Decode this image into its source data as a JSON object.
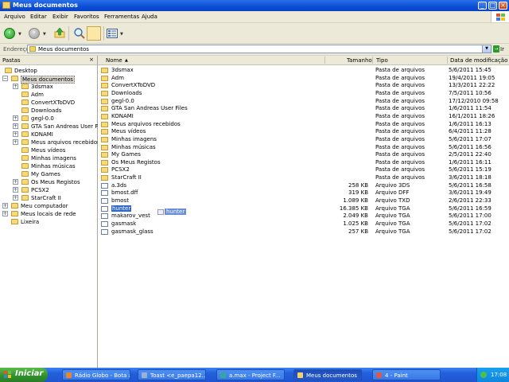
{
  "window": {
    "title": "Meus documentos"
  },
  "menu": [
    "Arquivo",
    "Editar",
    "Exibir",
    "Favoritos",
    "Ferramentas",
    "Ajuda"
  ],
  "address": {
    "label": "Endereço",
    "value": "Meus documentos",
    "go": "Ir"
  },
  "folder_pane": {
    "title": "Pastas",
    "close": "×",
    "tree": [
      {
        "label": "Desktop",
        "level": 0,
        "expander": ""
      },
      {
        "label": "Meus documentos",
        "level": 1,
        "expander": "−",
        "selected": true
      },
      {
        "label": "3dsmax",
        "level": 2,
        "expander": "+"
      },
      {
        "label": "Adm",
        "level": 2,
        "expander": ""
      },
      {
        "label": "ConvertXToDVD",
        "level": 2,
        "expander": ""
      },
      {
        "label": "Downloads",
        "level": 2,
        "expander": ""
      },
      {
        "label": "gegl-0.0",
        "level": 2,
        "expander": "+"
      },
      {
        "label": "GTA San Andreas User Files",
        "level": 2,
        "expander": "+"
      },
      {
        "label": "KONAMI",
        "level": 2,
        "expander": "+"
      },
      {
        "label": "Meus arquivos recebidos",
        "level": 2,
        "expander": "+"
      },
      {
        "label": "Meus vídeos",
        "level": 2,
        "expander": ""
      },
      {
        "label": "Minhas imagens",
        "level": 2,
        "expander": ""
      },
      {
        "label": "Minhas músicas",
        "level": 2,
        "expander": ""
      },
      {
        "label": "My Games",
        "level": 2,
        "expander": ""
      },
      {
        "label": "Os Meus Registos",
        "level": 2,
        "expander": "+"
      },
      {
        "label": "PCSX2",
        "level": 2,
        "expander": "+"
      },
      {
        "label": "StarCraft II",
        "level": 2,
        "expander": "+"
      },
      {
        "label": "Meu computador",
        "level": 1,
        "expander": "+"
      },
      {
        "label": "Meus locais de rede",
        "level": 1,
        "expander": "+"
      },
      {
        "label": "Lixeira",
        "level": 1,
        "expander": ""
      }
    ]
  },
  "columns": {
    "name": "Nome",
    "size": "Tamanho",
    "type": "Tipo",
    "date": "Data de modificação"
  },
  "files": [
    {
      "name": "3dsmax",
      "size": "",
      "type": "Pasta de arquivos",
      "date": "5/6/2011 15:45",
      "kind": "folder"
    },
    {
      "name": "Adm",
      "size": "",
      "type": "Pasta de arquivos",
      "date": "19/4/2011 19:05",
      "kind": "folder"
    },
    {
      "name": "ConvertXToDVD",
      "size": "",
      "type": "Pasta de arquivos",
      "date": "13/3/2011 22:22",
      "kind": "folder"
    },
    {
      "name": "Downloads",
      "size": "",
      "type": "Pasta de arquivos",
      "date": "7/5/2011 10:56",
      "kind": "folder"
    },
    {
      "name": "gegl-0.0",
      "size": "",
      "type": "Pasta de arquivos",
      "date": "17/12/2010 09:58",
      "kind": "folder"
    },
    {
      "name": "GTA San Andreas User Files",
      "size": "",
      "type": "Pasta de arquivos",
      "date": "1/6/2011 11:54",
      "kind": "folder"
    },
    {
      "name": "KONAMI",
      "size": "",
      "type": "Pasta de arquivos",
      "date": "16/1/2011 18:26",
      "kind": "folder"
    },
    {
      "name": "Meus arquivos recebidos",
      "size": "",
      "type": "Pasta de arquivos",
      "date": "1/6/2011 16:13",
      "kind": "folder"
    },
    {
      "name": "Meus vídeos",
      "size": "",
      "type": "Pasta de arquivos",
      "date": "6/4/2011 11:28",
      "kind": "folder"
    },
    {
      "name": "Minhas imagens",
      "size": "",
      "type": "Pasta de arquivos",
      "date": "5/6/2011 17:07",
      "kind": "folder"
    },
    {
      "name": "Minhas músicas",
      "size": "",
      "type": "Pasta de arquivos",
      "date": "5/6/2011 16:56",
      "kind": "folder"
    },
    {
      "name": "My Games",
      "size": "",
      "type": "Pasta de arquivos",
      "date": "2/5/2011 22:40",
      "kind": "folder"
    },
    {
      "name": "Os Meus Registos",
      "size": "",
      "type": "Pasta de arquivos",
      "date": "1/6/2011 16:11",
      "kind": "folder"
    },
    {
      "name": "PCSX2",
      "size": "",
      "type": "Pasta de arquivos",
      "date": "5/6/2011 15:19",
      "kind": "folder"
    },
    {
      "name": "StarCraft II",
      "size": "",
      "type": "Pasta de arquivos",
      "date": "3/6/2011 18:18",
      "kind": "folder"
    },
    {
      "name": "a.3ds",
      "size": "258 KB",
      "type": "Arquivo 3DS",
      "date": "5/6/2011 16:58",
      "kind": "file"
    },
    {
      "name": "bmost.dff",
      "size": "319 KB",
      "type": "Arquivo DFF",
      "date": "3/6/2011 19:49",
      "kind": "file"
    },
    {
      "name": "bmost",
      "size": "1.089 KB",
      "type": "Arquivo TXD",
      "date": "2/6/2011 22:33",
      "kind": "file"
    },
    {
      "name": "hunter",
      "size": "16.385 KB",
      "type": "Arquivo TGA",
      "date": "5/6/2011 16:59",
      "kind": "file",
      "selected": true
    },
    {
      "name": "makarov_vest",
      "size": "2.049 KB",
      "type": "Arquivo TGA",
      "date": "5/6/2011 17:00",
      "kind": "file"
    },
    {
      "name": "gasmask",
      "size": "1.025 KB",
      "type": "Arquivo TGA",
      "date": "5/6/2011 17:02",
      "kind": "file"
    },
    {
      "name": "gasmask_glass",
      "size": "257 KB",
      "type": "Arquivo TGA",
      "date": "5/6/2011 17:02",
      "kind": "file"
    }
  ],
  "drag_ghost": {
    "label": "hunter"
  },
  "taskbar": {
    "start": "Iniciar",
    "tasks": [
      {
        "label": "Rádio Globo - Bota a...",
        "color": "#e8862a",
        "active": false
      },
      {
        "label": "Toast <e_paepa12...",
        "color": "#9ab0d8",
        "active": false
      },
      {
        "label": "a.max - Project F...",
        "color": "#35a7a0",
        "active": false
      },
      {
        "label": "Meus documentos",
        "color": "#f2d36b",
        "active": true
      },
      {
        "label": "4 - Paint",
        "color": "#d85a4a",
        "active": false
      }
    ],
    "clock": "17:08"
  }
}
